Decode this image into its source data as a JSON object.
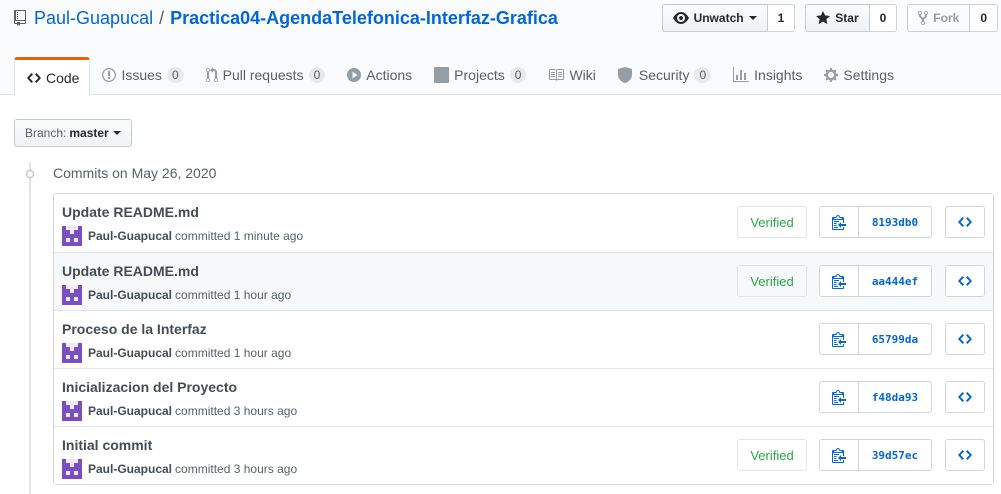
{
  "repo": {
    "owner": "Paul-Guapucal",
    "separator": "/",
    "name": "Practica04-AgendaTelefonica-Interfaz-Grafica"
  },
  "actions": {
    "watch": {
      "label": "Unwatch",
      "count": "1"
    },
    "star": {
      "label": "Star",
      "count": "0"
    },
    "fork": {
      "label": "Fork",
      "count": "0"
    }
  },
  "tabs": [
    {
      "label": "Code",
      "icon": "code-icon",
      "counter": ""
    },
    {
      "label": "Issues",
      "icon": "issue-icon",
      "counter": "0"
    },
    {
      "label": "Pull requests",
      "icon": "pull-request-icon",
      "counter": "0"
    },
    {
      "label": "Actions",
      "icon": "play-icon",
      "counter": ""
    },
    {
      "label": "Projects",
      "icon": "project-icon",
      "counter": "0"
    },
    {
      "label": "Wiki",
      "icon": "book-icon",
      "counter": ""
    },
    {
      "label": "Security",
      "icon": "shield-icon",
      "counter": "0"
    },
    {
      "label": "Insights",
      "icon": "graph-icon",
      "counter": ""
    },
    {
      "label": "Settings",
      "icon": "gear-icon",
      "counter": ""
    }
  ],
  "branch": {
    "label": "Branch:",
    "value": "master"
  },
  "commits_date": "Commits on May 26, 2020",
  "commits": [
    {
      "message": "Update README.md",
      "author": "Paul-Guapucal",
      "action": "committed",
      "time": "1 minute ago",
      "verified": "Verified",
      "sha": "8193db0"
    },
    {
      "message": "Update README.md",
      "author": "Paul-Guapucal",
      "action": "committed",
      "time": "1 hour ago",
      "verified": "Verified",
      "sha": "aa444ef"
    },
    {
      "message": "Proceso de la Interfaz",
      "author": "Paul-Guapucal",
      "action": "committed",
      "time": "1 hour ago",
      "verified": "",
      "sha": "65799da"
    },
    {
      "message": "Inicializacion del Proyecto",
      "author": "Paul-Guapucal",
      "action": "committed",
      "time": "3 hours ago",
      "verified": "",
      "sha": "f48da93"
    },
    {
      "message": "Initial commit",
      "author": "Paul-Guapucal",
      "action": "committed",
      "time": "3 hours ago",
      "verified": "Verified",
      "sha": "39d57ec"
    }
  ],
  "colors": {
    "link": "#0366d6",
    "selected_tab_accent": "#e36209",
    "verified": "#28a745",
    "avatar": "#6f42c1"
  }
}
